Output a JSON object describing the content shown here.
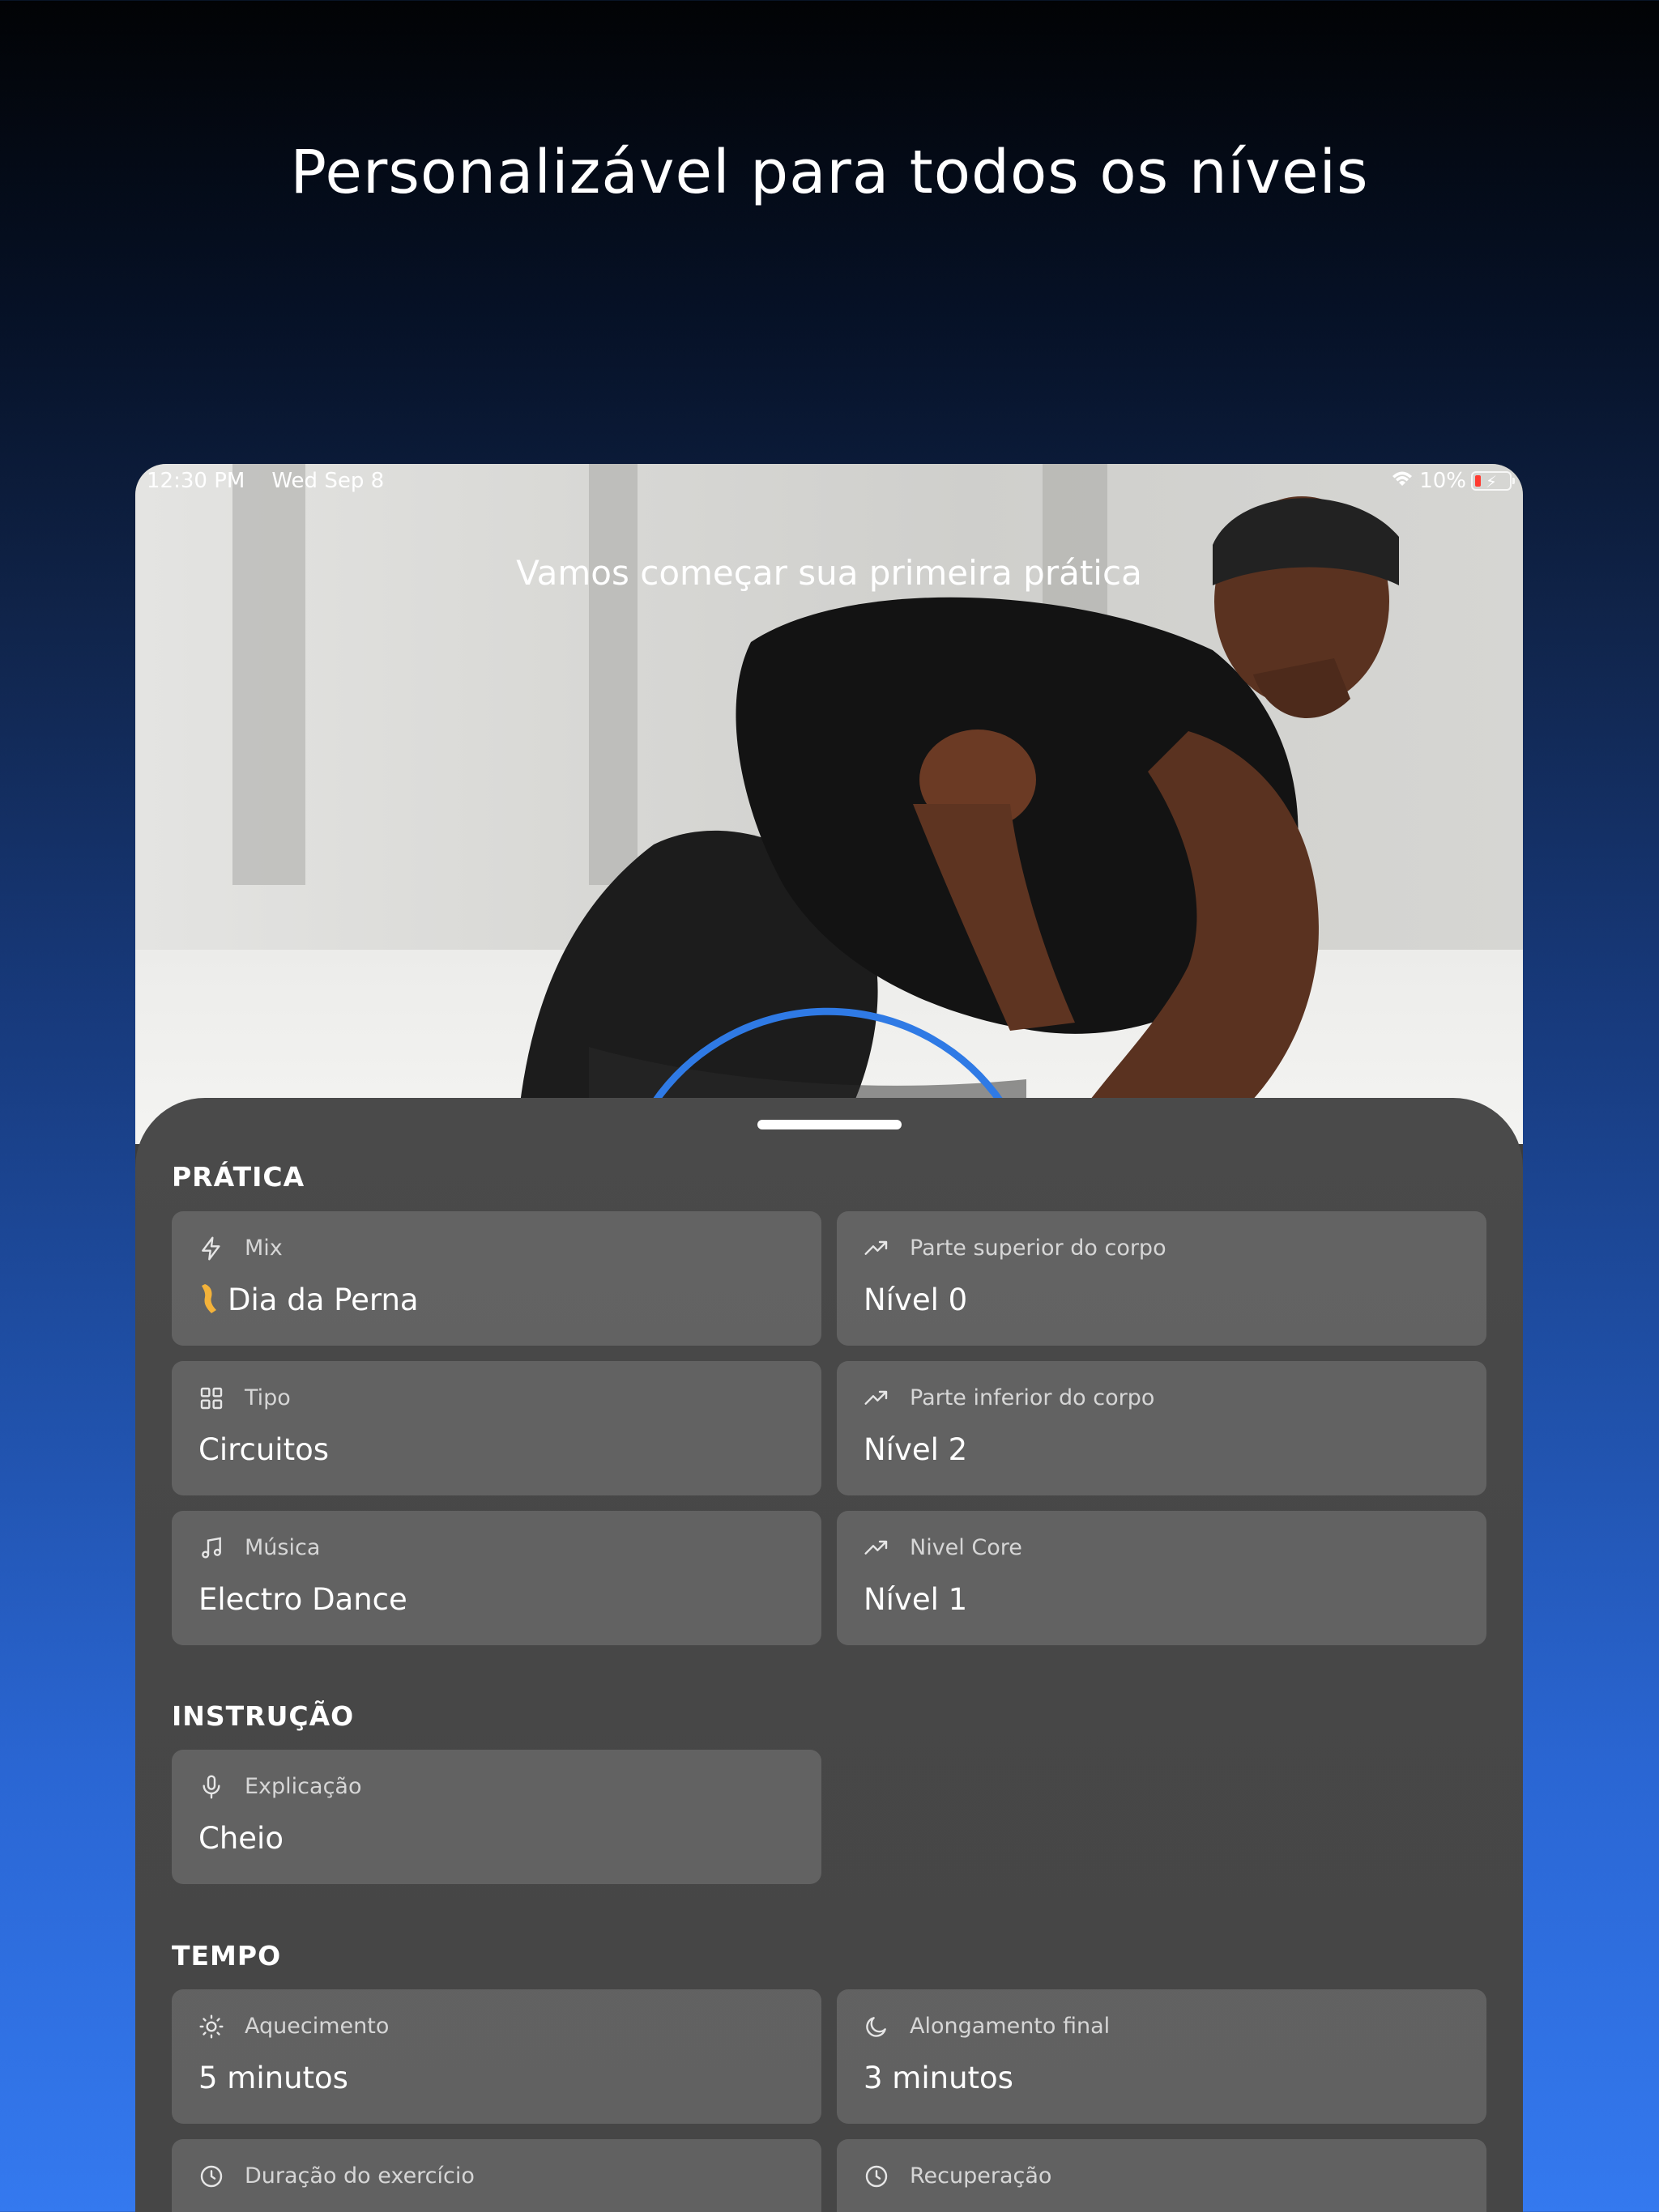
{
  "headline": "Personalizável para todos os níveis",
  "status_bar": {
    "time": "12:30 PM",
    "date": "Wed Sep 8",
    "battery": "10%"
  },
  "hero": {
    "title": "Vamos começar sua primeira prática"
  },
  "sections": {
    "pratica": "PRÁTICA",
    "instrucao": "INSTRUÇÃO",
    "tempo": "TEMPO"
  },
  "cards": {
    "mix": {
      "label": "Mix",
      "value": "Dia da Perna",
      "icon": "bolt-icon"
    },
    "upper": {
      "label": "Parte superior do corpo",
      "value": "Nível 0",
      "icon": "trend-up-icon"
    },
    "tipo": {
      "label": "Tipo",
      "value": "Circuitos",
      "icon": "grid-icon"
    },
    "lower": {
      "label": "Parte inferior do corpo",
      "value": "Nível 2",
      "icon": "trend-up-icon"
    },
    "musica": {
      "label": "Música",
      "value": "Electro Dance",
      "icon": "music-note-icon"
    },
    "core": {
      "label": "Nivel Core",
      "value": "Nível 1",
      "icon": "trend-up-icon"
    },
    "explicacao": {
      "label": "Explicação",
      "value": "Cheio",
      "icon": "microphone-icon"
    },
    "aquecimento": {
      "label": "Aquecimento",
      "value": "5 minutos",
      "icon": "sun-icon"
    },
    "alongamento": {
      "label": "Alongamento final",
      "value": "3 minutos",
      "icon": "moon-icon"
    },
    "duracao": {
      "label": "Duração do exercício",
      "icon": "clock-icon"
    },
    "recuperacao": {
      "label": "Recuperação",
      "icon": "clock-icon"
    }
  },
  "colors": {
    "background_top": "#020305",
    "background_bottom": "#3479ef",
    "sheet": "#474747",
    "card": "#6a6a6a",
    "battery_low": "#ff3b30",
    "progress_arc": "#2f7ae5"
  }
}
